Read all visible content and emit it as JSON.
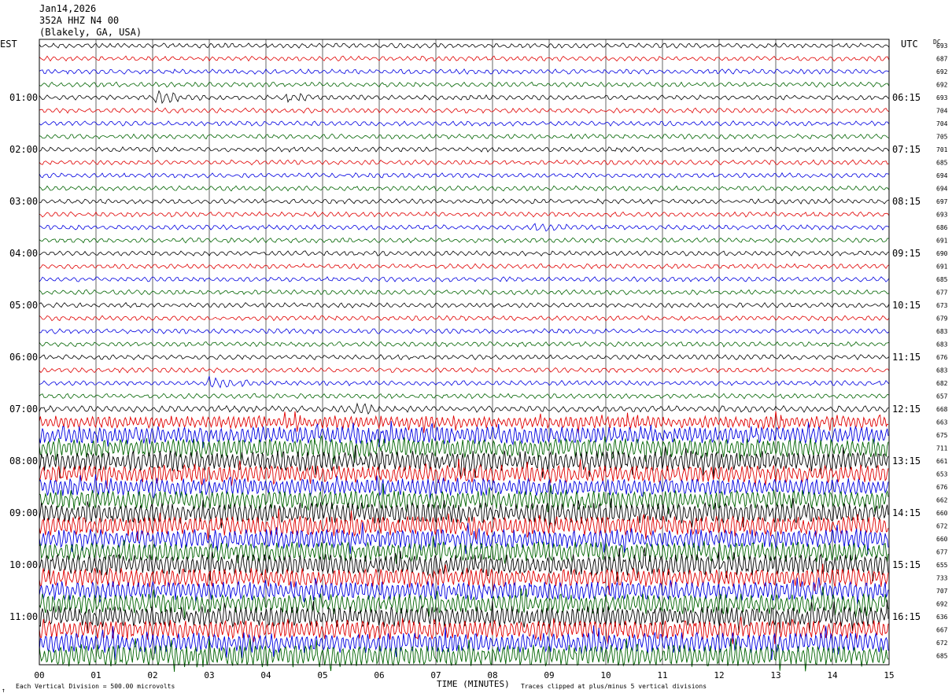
{
  "header": {
    "date": "Jan14,2026",
    "station": "352A HHZ N4 00",
    "location": "(Blakely, GA, USA)"
  },
  "left_zone": "EST",
  "right_zone": "UTC",
  "dc_label": "DC",
  "footer": {
    "scale_note": "Each Vertical Division =  500.00 microvolts",
    "clip_note": "Traces clipped at plus/minus 5 vertical divisions",
    "corner_mark": "↑"
  },
  "colors": {
    "cycle": [
      "#000000",
      "#e00000",
      "#0000e0",
      "#006400"
    ],
    "grid": "#000000"
  },
  "chart_data": {
    "type": "line",
    "title": "",
    "xlabel": "TIME (MINUTES)",
    "ylabel": "",
    "x_ticks": [
      "00",
      "01",
      "02",
      "03",
      "04",
      "05",
      "06",
      "07",
      "08",
      "09",
      "10",
      "11",
      "12",
      "13",
      "14",
      "15"
    ],
    "xlim": [
      0,
      15
    ],
    "left_hour_labels": [
      "01:00",
      "02:00",
      "03:00",
      "04:00",
      "05:00",
      "06:00",
      "07:00",
      "08:00",
      "09:00",
      "10:00",
      "11:00"
    ],
    "right_hour_labels": [
      "06:15",
      "07:15",
      "08:15",
      "09:15",
      "10:15",
      "11:15",
      "12:15",
      "13:15",
      "14:15",
      "15:15",
      "16:15"
    ],
    "trace_count": 48,
    "traces_per_hour": 4,
    "dc_offsets": [
      693,
      687,
      692,
      692,
      693,
      704,
      704,
      705,
      701,
      685,
      694,
      694,
      697,
      693,
      686,
      691,
      690,
      691,
      685,
      677,
      673,
      679,
      683,
      683,
      676,
      683,
      682,
      657,
      668,
      663,
      675,
      711,
      661,
      653,
      676,
      662,
      660,
      672,
      660,
      677,
      655,
      733,
      707,
      692,
      636,
      667,
      672,
      685
    ],
    "noise_amplitude_by_trace": [
      1,
      1,
      1,
      1,
      1,
      1,
      1,
      1,
      1,
      1,
      1,
      1,
      1,
      1,
      1,
      1,
      1,
      1,
      1,
      1,
      1,
      1,
      1,
      1,
      1,
      1,
      1,
      1,
      1.3,
      2.5,
      3.5,
      3.8,
      4,
      3.5,
      3.5,
      3.8,
      4.2,
      4,
      3.8,
      4,
      4.2,
      3.8,
      3.8,
      4,
      4.2,
      3.8,
      4,
      4.5
    ],
    "events": [
      {
        "trace": 4,
        "minute": 2.1,
        "amplitude": 2.5
      },
      {
        "trace": 4,
        "minute": 4.4,
        "amplitude": 1.4
      },
      {
        "trace": 26,
        "minute": 3.0,
        "amplitude": 2.0
      },
      {
        "trace": 28,
        "minute": 5.6,
        "amplitude": 1.8
      },
      {
        "trace": 14,
        "minute": 8.7,
        "amplitude": 1.4
      }
    ],
    "grid": true
  }
}
